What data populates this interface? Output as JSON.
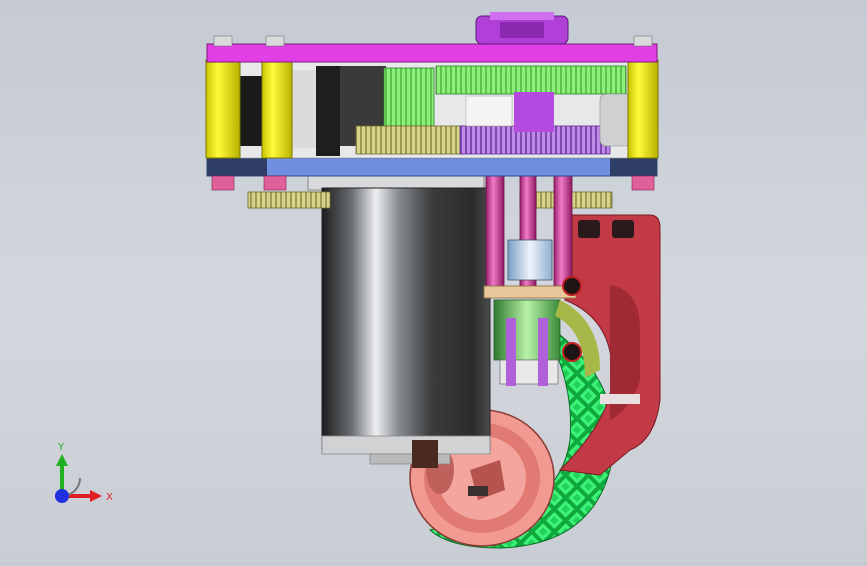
{
  "viewport": {
    "background_top": "#c5cad3",
    "background_bottom": "#c9cdd4"
  },
  "model": {
    "parts": [
      "top-plate",
      "bottom-plate",
      "yellow-spacer-posts",
      "gear-train",
      "drive-motor",
      "vertical-shafts",
      "coupling-block",
      "red-mounting-bracket",
      "wheel-hub",
      "green-tread-tire"
    ],
    "colors": {
      "top_plate": "#e23ee6",
      "bottom_plate": "#6f8fe0",
      "posts": "#f3f11a",
      "gear_green": "#8cf07a",
      "gear_purple": "#b56be8",
      "motor_body": "#2f3133",
      "bracket": "#c23a46",
      "hub": "#f29a92",
      "tire": "#22e85e"
    }
  },
  "triad": {
    "x_label": "X",
    "y_label": "Y",
    "x_color": "#e02020",
    "y_color": "#20b020",
    "z_color": "#2030e0"
  }
}
